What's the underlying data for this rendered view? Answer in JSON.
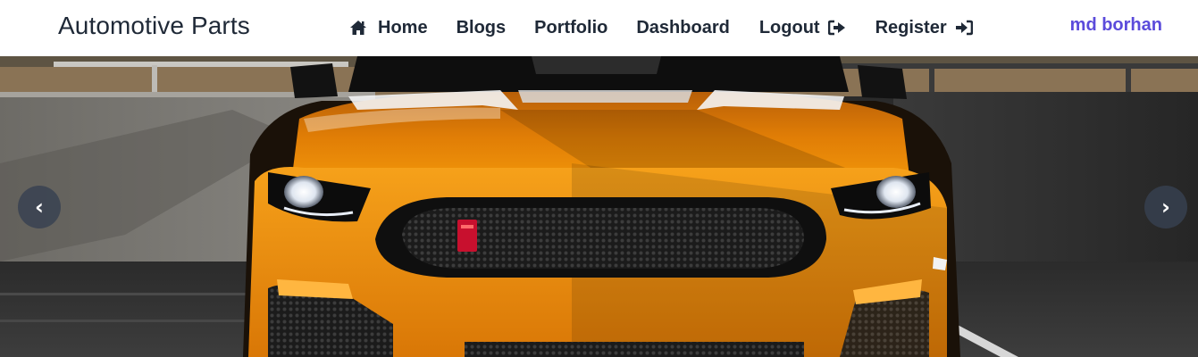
{
  "navbar": {
    "brand": "Automotive Parts",
    "links": {
      "home": {
        "label": "Home",
        "icon": "home-icon"
      },
      "blogs": {
        "label": "Blogs"
      },
      "portfolio": {
        "label": "Portfolio"
      },
      "dashboard": {
        "label": "Dashboard"
      },
      "logout": {
        "label": "Logout",
        "icon": "sign-out-icon"
      },
      "register": {
        "label": "Register",
        "icon": "sign-in-icon"
      }
    },
    "user": "md borhan"
  },
  "hero": {
    "image": "orange-sports-car-front",
    "prev_icon": "‹",
    "next_icon": "›"
  },
  "colors": {
    "nav_text": "#1f2937",
    "user_accent": "#5b4bdb",
    "car_orange": "#f59a0a",
    "carousel_button": "#374151"
  }
}
